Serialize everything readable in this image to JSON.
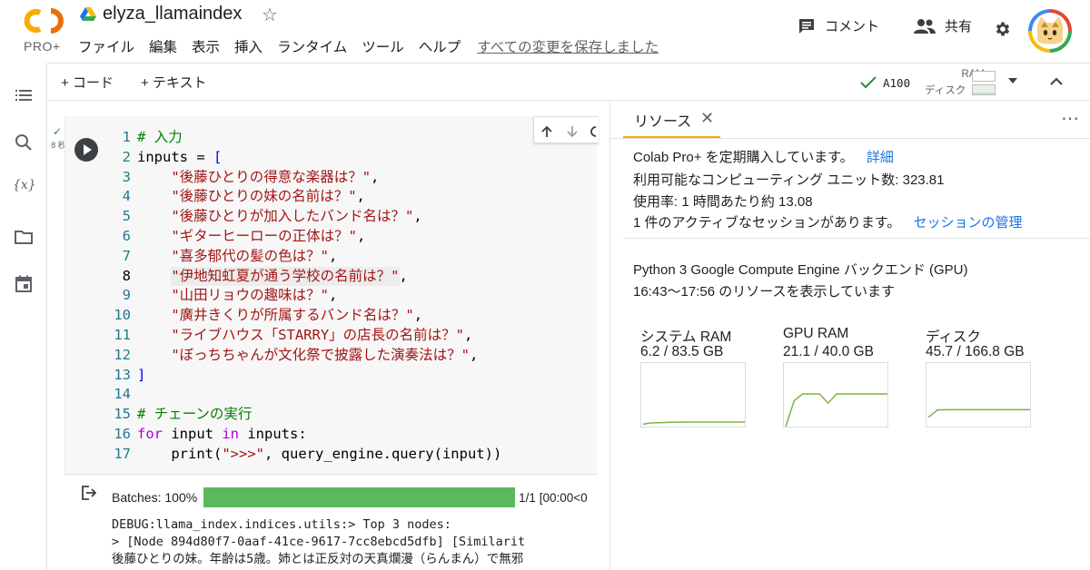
{
  "header": {
    "logo_text": "CO",
    "logo_sub": "PRO+",
    "title": "elyza_llamaindex",
    "menu": [
      "ファイル",
      "編集",
      "表示",
      "挿入",
      "ランタイム",
      "ツール",
      "ヘルプ"
    ],
    "saved_status": "すべての変更を保存しました",
    "comment_label": "コメント",
    "share_label": "共有"
  },
  "toolbar": {
    "add_code": "+ コード",
    "add_text": "+ テキスト",
    "accelerator": "A100",
    "ram_label": "RAM",
    "disk_label": "ディスク"
  },
  "cell": {
    "exec_mark": "✓",
    "exec_time": "8 秒",
    "lines": [
      {
        "n": "1",
        "t": [
          {
            "c": "cm",
            "v": "# 入力"
          }
        ]
      },
      {
        "n": "2",
        "t": [
          {
            "c": "tx",
            "v": "inputs = "
          },
          {
            "c": "bl",
            "v": "["
          }
        ]
      },
      {
        "n": "3",
        "t": [
          {
            "c": "tx",
            "v": "    "
          },
          {
            "c": "st",
            "v": "\"後藤ひとりの得意な楽器は？\""
          },
          {
            "c": "tx",
            "v": ","
          }
        ]
      },
      {
        "n": "4",
        "t": [
          {
            "c": "tx",
            "v": "    "
          },
          {
            "c": "st",
            "v": "\"後藤ひとりの妹の名前は？\""
          },
          {
            "c": "tx",
            "v": ","
          }
        ]
      },
      {
        "n": "5",
        "t": [
          {
            "c": "tx",
            "v": "    "
          },
          {
            "c": "st",
            "v": "\"後藤ひとりが加入したバンド名は？\""
          },
          {
            "c": "tx",
            "v": ","
          }
        ]
      },
      {
        "n": "6",
        "t": [
          {
            "c": "tx",
            "v": "    "
          },
          {
            "c": "st",
            "v": "\"ギターヒーローの正体は？\""
          },
          {
            "c": "tx",
            "v": ","
          }
        ]
      },
      {
        "n": "7",
        "t": [
          {
            "c": "tx",
            "v": "    "
          },
          {
            "c": "st",
            "v": "\"喜多郁代の髪の色は？\""
          },
          {
            "c": "tx",
            "v": ","
          }
        ]
      },
      {
        "n": "8",
        "active": true,
        "t": [
          {
            "c": "tx",
            "v": "    "
          },
          {
            "c": "st hl",
            "v": "\"伊地知虹夏が通う学校の名前は？\""
          },
          {
            "c": "tx",
            "v": ","
          }
        ]
      },
      {
        "n": "9",
        "t": [
          {
            "c": "tx",
            "v": "    "
          },
          {
            "c": "st",
            "v": "\"山田リョウの趣味は？\""
          },
          {
            "c": "tx",
            "v": ","
          }
        ]
      },
      {
        "n": "10",
        "t": [
          {
            "c": "tx",
            "v": "    "
          },
          {
            "c": "st",
            "v": "\"廣井きくりが所属するバンド名は？\""
          },
          {
            "c": "tx",
            "v": ","
          }
        ]
      },
      {
        "n": "11",
        "t": [
          {
            "c": "tx",
            "v": "    "
          },
          {
            "c": "st",
            "v": "\"ライブハウス「STARRY」の店長の名前は？\""
          },
          {
            "c": "tx",
            "v": ","
          }
        ]
      },
      {
        "n": "12",
        "t": [
          {
            "c": "tx",
            "v": "    "
          },
          {
            "c": "st",
            "v": "\"ぼっちちゃんが文化祭で披露した演奏法は？\""
          },
          {
            "c": "tx",
            "v": ","
          }
        ]
      },
      {
        "n": "13",
        "t": [
          {
            "c": "bl",
            "v": "]"
          }
        ]
      },
      {
        "n": "14",
        "t": []
      },
      {
        "n": "15",
        "t": [
          {
            "c": "cm",
            "v": "# チェーンの実行"
          }
        ]
      },
      {
        "n": "16",
        "t": [
          {
            "c": "kw",
            "v": "for"
          },
          {
            "c": "tx",
            "v": " input "
          },
          {
            "c": "kw",
            "v": "in"
          },
          {
            "c": "tx",
            "v": " inputs:"
          }
        ]
      },
      {
        "n": "17",
        "t": [
          {
            "c": "tx",
            "v": "    print("
          },
          {
            "c": "st",
            "v": "\">>>\""
          },
          {
            "c": "tx",
            "v": ", query_engine.query(input))"
          }
        ]
      }
    ]
  },
  "output": {
    "progress_label": "Batches: 100%",
    "progress_fraction": 1.0,
    "progress_right": "1/1 [00:00<0",
    "debug_lines": [
      "DEBUG:llama_index.indices.utils:> Top 3 nodes:",
      "> [Node 894d80f7-0aaf-41ce-9617-7cc8ebcd5dfb] [Similarit",
      "後藤ひとりの妹。年齢は5歳。姉とは正反対の天真爛漫（らんまん）で無邪"
    ]
  },
  "panel": {
    "tab_label": "リソース",
    "subscription": "Colab Pro+ を定期購入しています。",
    "details_link": "詳細",
    "compute_units": "利用可能なコンピューティング ユニット数: 323.81",
    "usage_rate": "使用率: 1 時間あたり約 13.08",
    "sessions": "1 件のアクティブなセッションがあります。",
    "manage_link": "セッションの管理",
    "backend": "Python 3 Google Compute Engine バックエンド (GPU)",
    "timerange": "16:43〜17:56 のリソースを表示しています",
    "graphs": [
      {
        "title": "システム RAM",
        "value": "6.2 / 83.5 GB",
        "series": [
          0.04,
          0.06,
          0.065,
          0.07,
          0.072,
          0.074,
          0.074,
          0.074,
          0.074,
          0.074,
          0.074,
          0.074
        ]
      },
      {
        "title": "GPU RAM",
        "value": "21.1 / 40.0 GB",
        "series": [
          0.0,
          0.42,
          0.53,
          0.53,
          0.53,
          0.38,
          0.53,
          0.53,
          0.53,
          0.53,
          0.53,
          0.53,
          0.53
        ]
      },
      {
        "title": "ディスク",
        "value": "45.7 / 166.8 GB",
        "series": [
          0.15,
          0.27,
          0.274,
          0.274,
          0.274,
          0.274,
          0.274,
          0.274,
          0.274,
          0.274,
          0.274,
          0.274
        ]
      }
    ]
  },
  "colors": {
    "accent": "#f9ab00",
    "progress": "#5cb85c",
    "graph_line": "#7cb342",
    "link": "#1a73e8"
  }
}
